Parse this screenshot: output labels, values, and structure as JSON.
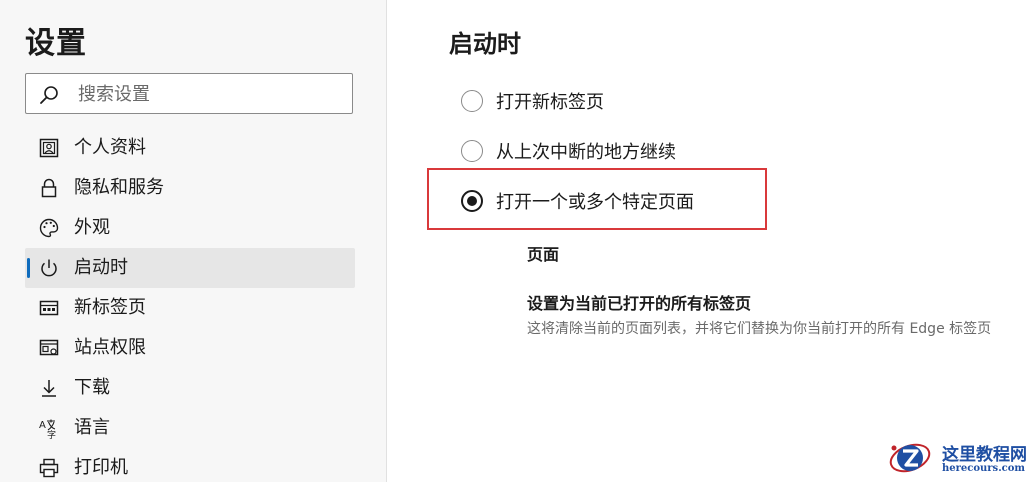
{
  "sidebar": {
    "title": "设置",
    "search": {
      "placeholder": "搜索设置",
      "icon": "search-icon"
    },
    "items": [
      {
        "label": "个人资料",
        "icon": "profile-icon",
        "active": false
      },
      {
        "label": "隐私和服务",
        "icon": "lock-icon",
        "active": false
      },
      {
        "label": "外观",
        "icon": "palette-icon",
        "active": false
      },
      {
        "label": "启动时",
        "icon": "power-icon",
        "active": true
      },
      {
        "label": "新标签页",
        "icon": "new-tab-icon",
        "active": false
      },
      {
        "label": "站点权限",
        "icon": "site-permissions-icon",
        "active": false
      },
      {
        "label": "下载",
        "icon": "download-icon",
        "active": false
      },
      {
        "label": "语言",
        "icon": "language-icon",
        "active": false
      },
      {
        "label": "打印机",
        "icon": "printer-icon",
        "active": false
      }
    ]
  },
  "main": {
    "section_title": "启动时",
    "options": [
      {
        "label": "打开新标签页",
        "checked": false
      },
      {
        "label": "从上次中断的地方继续",
        "checked": false
      },
      {
        "label": "打开一个或多个特定页面",
        "checked": true
      }
    ],
    "pages_heading": "页面",
    "set_current": {
      "title": "设置为当前已打开的所有标签页",
      "description": "这将清除当前的页面列表，并将它们替换为你当前打开的所有 Edge 标签页"
    }
  },
  "watermark": {
    "title": "这里教程网",
    "subtitle": "herecours.com"
  },
  "colors": {
    "accent": "#0f6cbd",
    "highlight_border": "#d9393b",
    "sidebar_bg": "#f7f7f7",
    "active_item_bg": "#e6e6e6"
  }
}
